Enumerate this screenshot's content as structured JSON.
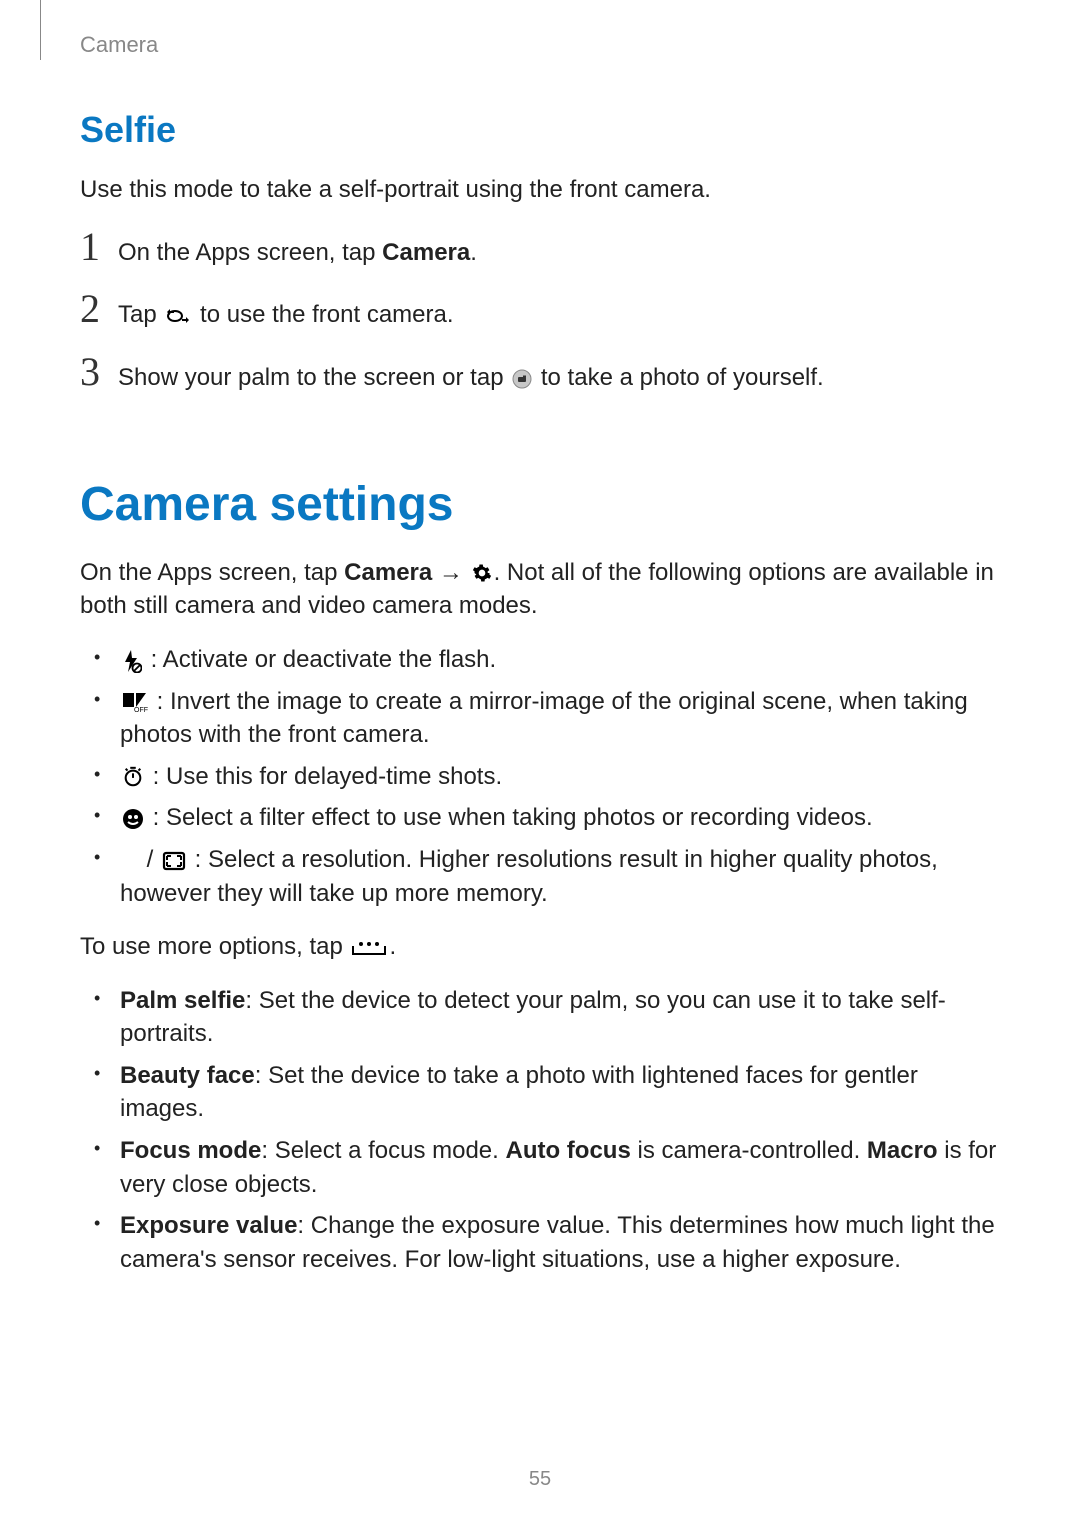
{
  "header": {
    "section": "Camera"
  },
  "selfie": {
    "heading": "Selfie",
    "intro": "Use this mode to take a self-portrait using the front camera.",
    "steps": {
      "s1": {
        "num": "1",
        "pre": "On the Apps screen, tap ",
        "bold": "Camera",
        "post": "."
      },
      "s2": {
        "num": "2",
        "pre": "Tap ",
        "post": " to use the front camera."
      },
      "s3": {
        "num": "3",
        "pre": "Show your palm to the screen or tap ",
        "post": " to take a photo of yourself."
      }
    }
  },
  "settings": {
    "heading": "Camera settings",
    "intro": {
      "pre": "On the Apps screen, tap ",
      "bold": "Camera",
      "arrow": " → ",
      "post": ". Not all of the following options are available in both still camera and video camera modes."
    },
    "iconItems": {
      "flash": " : Activate or deactivate the flash.",
      "mirror": " : Invert the image to create a mirror-image of the original scene, when taking photos with the front camera.",
      "timer": " : Use this for delayed-time shots.",
      "filter": " : Select a filter effect to use when taking photos or recording videos.",
      "resolution": {
        "sep": " / ",
        "desc": " : Select a resolution. Higher resolutions result in higher quality photos, however they will take up more memory."
      }
    },
    "moreIntro": {
      "pre": "To use more options, tap ",
      "post": "."
    },
    "moreItems": {
      "palm": {
        "label": "Palm selfie",
        "desc": ": Set the device to detect your palm, so you can use it to take self-portraits."
      },
      "beauty": {
        "label": "Beauty face",
        "desc": ": Set the device to take a photo with lightened faces for gentler images."
      },
      "focus": {
        "label": "Focus mode",
        "desc1": ": Select a focus mode. ",
        "bold1": "Auto focus",
        "desc2": " is camera-controlled. ",
        "bold2": "Macro",
        "desc3": " is for very close objects."
      },
      "exposure": {
        "label": "Exposure value",
        "desc": ": Change the exposure value. This determines how much light the camera's sensor receives. For low-light situations, use a higher exposure."
      }
    }
  },
  "pageNumber": "55"
}
